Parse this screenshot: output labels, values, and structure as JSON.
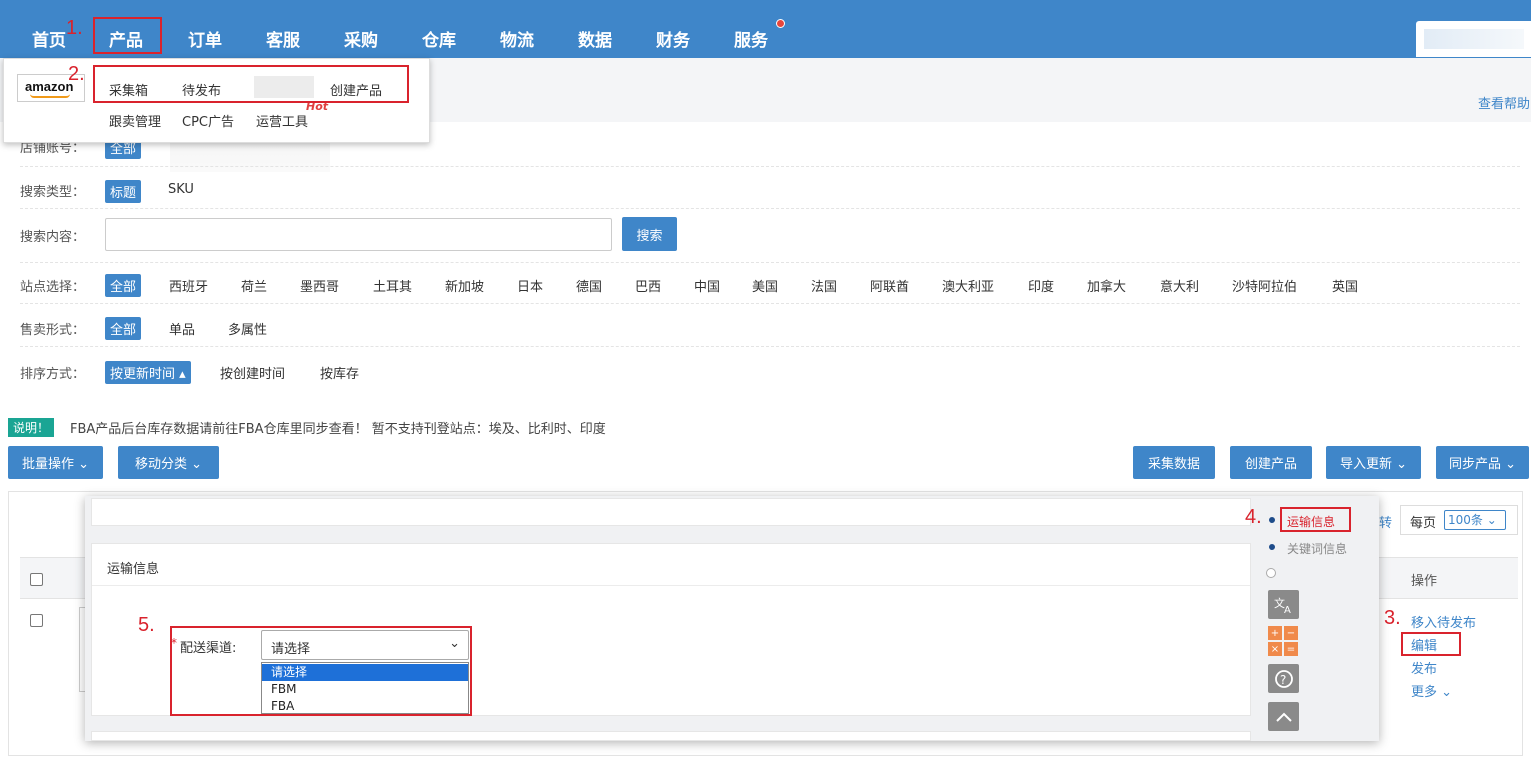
{
  "nav": {
    "items": [
      "首页",
      "产品",
      "订单",
      "客服",
      "采购",
      "仓库",
      "物流",
      "数据",
      "财务",
      "服务"
    ]
  },
  "product_menu": {
    "logo": "amazon",
    "row1": [
      "采集箱",
      "待发布",
      "创建产品"
    ],
    "row2": [
      "跟卖管理",
      "CPC广告",
      "运营工具"
    ],
    "hot": "Hot"
  },
  "help": "查看帮助",
  "steps": [
    "1.",
    "2.",
    "3.",
    "4.",
    "5."
  ],
  "filters": {
    "shop_label": "店铺账号：",
    "shop_all": "全部",
    "search_type_label": "搜索类型：",
    "search_types": [
      "标题",
      "SKU"
    ],
    "search_content_label": "搜索内容：",
    "search_button": "搜索",
    "site_label": "站点选择：",
    "sites": [
      "全部",
      "西班牙",
      "荷兰",
      "墨西哥",
      "土耳其",
      "新加坡",
      "日本",
      "德国",
      "巴西",
      "中国",
      "美国",
      "法国",
      "阿联酋",
      "澳大利亚",
      "印度",
      "加拿大",
      "意大利",
      "沙特阿拉伯",
      "英国"
    ],
    "sale_label": "售卖形式：",
    "sales": [
      "全部",
      "单品",
      "多属性"
    ],
    "sort_label": "排序方式：",
    "sorts": [
      "按更新时间 ▴",
      "按创建时间",
      "按库存"
    ]
  },
  "notice": {
    "tag": "说明！",
    "text": "FBA产品后台库存数据请前往FBA仓库里同步查看！ 暂不支持刊登站点：埃及、比利时、印度"
  },
  "toolbar": {
    "batch": "批量操作 ⌄",
    "move": "移动分类 ⌄",
    "collect": "采集数据",
    "create": "创建产品",
    "import": "导入更新 ⌄",
    "sync": "同步产品 ⌄"
  },
  "table": {
    "jump": "转",
    "per_page_label": "每页",
    "per_page_value": "100条 ⌄",
    "op_header": "操作",
    "ops": [
      "移入待发布",
      "编辑",
      "发布",
      "更多 ⌄"
    ]
  },
  "modal": {
    "section_title": "运输信息",
    "field_label": "配送渠道:",
    "select_value": "请选择",
    "options": [
      "请选择",
      "FBM",
      "FBA"
    ],
    "side_nav": [
      "运输信息",
      "关键词信息"
    ]
  }
}
